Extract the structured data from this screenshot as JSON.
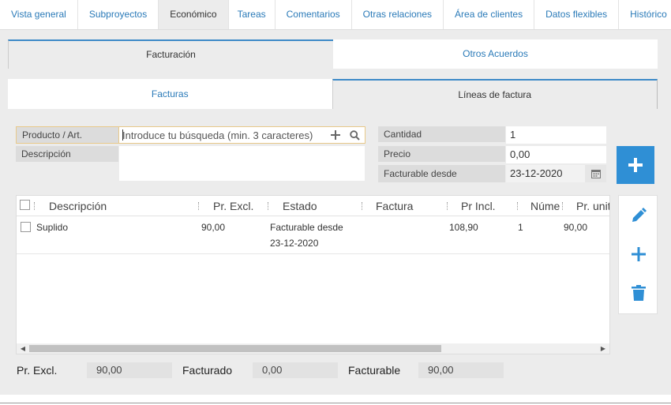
{
  "top_tabs": [
    "Vista general",
    "Subproyectos",
    "Económico",
    "Tareas",
    "Comentarios",
    "Otras relaciones",
    "Área de clientes",
    "Datos flexibles",
    "Histórico"
  ],
  "sub_tabs": [
    "Facturación",
    "Otros Acuerdos"
  ],
  "sub_tabs2": [
    "Facturas",
    "Líneas de factura"
  ],
  "form": {
    "product_label": "Producto / Art.",
    "search_placeholder": "Introduce tu búsqueda (min. 3 caracteres)",
    "description_label": "Descripción",
    "quantity_label": "Cantidad",
    "quantity_value": "1",
    "price_label": "Precio",
    "price_value": "0,00",
    "billable_label": "Facturable desde",
    "billable_value": "23-12-2020"
  },
  "table": {
    "headers": [
      "Descripción",
      "Pr. Excl.",
      "Estado",
      "Factura",
      "Pr Incl.",
      "Núme",
      "Pr. unit"
    ],
    "rows": [
      {
        "descripcion": "Suplido",
        "pr_excl": "90,00",
        "estado_1": "Facturable desde",
        "estado_2": "23-12-2020",
        "factura": "",
        "pr_incl": "108,90",
        "numero": "1",
        "pr_unit": "90,00"
      }
    ]
  },
  "totals": {
    "excl_label": "Pr. Excl.",
    "excl_value": "90,00",
    "facturado_label": "Facturado",
    "facturado_value": "0,00",
    "facturable_label": "Facturable",
    "facturable_value": "90,00"
  },
  "colors": {
    "accent": "#2f8fd5",
    "link": "#2a7ab8",
    "panel": "#ececec"
  }
}
